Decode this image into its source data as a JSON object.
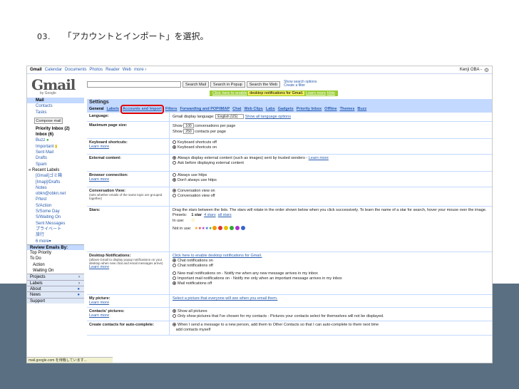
{
  "slide": {
    "step_number": "03.",
    "step_text": "「アカウントとインポート」を選択。"
  },
  "topbar": {
    "links": [
      "Gmail",
      "Calendar",
      "Documents",
      "Photos",
      "Reader",
      "Web",
      "more ›"
    ],
    "user": "Kenji OBA -"
  },
  "logo": {
    "text": "Gmail",
    "by": "by Google"
  },
  "search": {
    "buttons": [
      "Search Mail",
      "Search in Popup",
      "Search the Web"
    ],
    "links": [
      "Show search options",
      "Create a filter"
    ]
  },
  "notice": {
    "link": "Click here to enable",
    "middle": "desktop notifications for Gmail.",
    "learn": "Learn more",
    "hide": "Hide"
  },
  "leftnav": {
    "items": [
      "Mail",
      "Contacts",
      "Tasks"
    ],
    "compose": "Compose mail",
    "folders": [
      "Priority Inbox (2)",
      "Inbox (6)",
      "Buzz",
      "Important",
      "Sent Mail",
      "Drafts",
      "Spam"
    ],
    "recent_header": "« Recent Labels",
    "labels": [
      "[Gmail]ゴミ箱",
      "[Imap]/Drafts",
      "Notes",
      "obkn@obkn.net",
      "P/test",
      "S/Action",
      "S/Some Day",
      "S/Waiting On",
      "Sent Messages",
      "プライベート",
      "旅行",
      "6 more▾"
    ],
    "review": "Review Emails By:",
    "review_items": [
      "Top Priority",
      "To Do",
      "Action",
      "Waiting On"
    ],
    "gadgets": [
      "Projects",
      "Labels",
      "About",
      "News",
      "Support"
    ]
  },
  "settings": {
    "title": "Settings",
    "tabs": [
      "General",
      "Labels",
      "Accounts and Import",
      "Filters",
      "Forwarding and POP/IMAP",
      "Chat",
      "Web Clips",
      "Labs",
      "Gadgets",
      "Priority Inbox",
      "Offline",
      "Themes",
      "Buzz"
    ],
    "language_label": "Language:",
    "language_text": "Gmail display language:",
    "language_value": "English (US)",
    "language_link": "Show all language options",
    "pagesize_label": "Maximum page size:",
    "pagesize_show": "Show",
    "pagesize_conv_value": "100",
    "pagesize_conv": "conversations per page",
    "pagesize_contacts_value": "250",
    "pagesize_contacts": "contacts per page",
    "kbd_label": "Keyboard shortcuts:",
    "kbd_learn": "Learn more",
    "kbd_off": "Keyboard shortcuts off",
    "kbd_on": "Keyboard shortcuts on",
    "ext_label": "External content:",
    "ext_always": "Always display external content (such as images) sent by trusted senders -",
    "ext_learn": "Learn more",
    "ext_ask": "Ask before displaying external content",
    "browser_label": "Browser connection:",
    "browser_learn": "Learn more",
    "browser_always": "Always use https",
    "browser_dont": "Don't always use https",
    "conv_label": "Conversation View:",
    "conv_sub": "(sets whether emails of the same topic are grouped together)",
    "conv_on": "Conversation view on",
    "conv_off": "Conversation view off",
    "stars_label": "Stars:",
    "stars_desc": "Drag the stars between the lists.  The stars will rotate in the order shown below when you click successively. To learn the name of a star for search, hover your mouse over the image.",
    "stars_presets": "Presets:",
    "stars_1": "1 star",
    "stars_4": "4 stars",
    "stars_all": "all stars",
    "stars_inuse": "In use:",
    "stars_notinuse": "Not in use:",
    "desk_label": "Desktop Notifications:",
    "desk_sub": "(allows Gmail to display popup notifications on your desktop when new chat and email messages arrive)",
    "desk_learn": "Learn more",
    "desk_link": "Click here to enable desktop notifications for Gmail.",
    "desk_chat_on": "Chat notifications on",
    "desk_chat_off": "Chat notifications off",
    "desk_new": "New mail notifications on - Notify me when any new message arrives in my inbox",
    "desk_important": "Important mail notifications on - Notify me only when an important message arrives in my inbox",
    "desk_mail_off": "Mail notifications off",
    "pic_label": "My picture:",
    "pic_learn": "Learn more",
    "pic_text": "Select a picture that everyone will see when you email them.",
    "cpic_label": "Contacts' pictures:",
    "cpic_learn": "Learn more",
    "cpic_all": "Show all pictures",
    "cpic_only": "Only show pictures that I've chosen for my contacts - Pictures your contacts select for themselves will not be displayed.",
    "auto_label": "Create contacts for auto-complete:",
    "auto_on": "When I send a message to a new person, add them to Other Contacts so that I can auto-complete to them next time",
    "auto_off": "add contacts myself"
  },
  "statusbar": "mail.google.com を待機しています...",
  "colors": {
    "accent": "#c3d9ff",
    "highlight": "#e00000",
    "band": "#5a6f82"
  }
}
